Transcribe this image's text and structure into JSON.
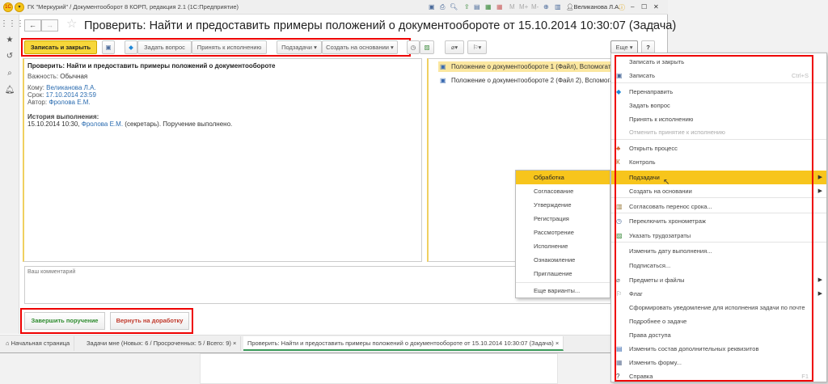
{
  "app": {
    "title": "ГК \"Меркурий\" / Документооборот 8 КОРП, редакция 2.1  (1С:Предприятие)",
    "user": "Великанова Л.А.",
    "memory_buttons": [
      "M",
      "M+",
      "M-"
    ]
  },
  "form": {
    "title": "Проверить: Найти и предоставить примеры положений о документообороте от 15.10.2014 10:30:07 (Задача)"
  },
  "toolbar": {
    "save_close": "Записать и закрыть",
    "ask": "Задать вопрос",
    "accept": "Принять к исполнению",
    "subtasks": "Подзадачи",
    "create_based": "Создать на основании",
    "more": "Еще",
    "help": "?"
  },
  "task": {
    "heading": "Проверить: Найти и предоставить примеры положений о документообороте",
    "importance_label": "Важность:",
    "importance": "Обычная",
    "to_label": "Кому:",
    "to": "Великанова Л.А.",
    "due_label": "Срок:",
    "due": "17.10.2014 23:59",
    "author_label": "Автор:",
    "author": "Фролова Е.М.",
    "history_label": "История выполнения:",
    "history_prefix": "15.10.2014 10:30,",
    "history_person": "Фролова Е.М.",
    "history_suffix": "(секретарь). Поручение выполнено."
  },
  "files": [
    "Положение о документообороте 1 (Файл), Вспомогатель",
    "Положение о документообороте 2 (Файл 2), Вспомогател"
  ],
  "comment": {
    "placeholder": "Ваш комментарий"
  },
  "actions": {
    "complete": "Завершить поручение",
    "return": "Вернуть на доработку"
  },
  "colors": {
    "accent": "#f7c51c",
    "highlight_box": "#e00000",
    "complete": "#2e8b2e",
    "return": "#c0392b"
  },
  "tabs": [
    {
      "label": "Начальная страница",
      "icon": "home-icon"
    },
    {
      "label": "Задачи мне (Новых: 6 / Просроченных: 5 / Всего: 9)"
    },
    {
      "label": "Проверить: Найти и предоставить примеры положений о документообороте от 15.10.2014 10:30:07 (Задача)",
      "active": true
    }
  ],
  "more_menu": [
    {
      "label": "Записать и закрыть"
    },
    {
      "label": "Записать",
      "shortcut": "Ctrl+S",
      "icon": "save-icon"
    },
    {
      "label": "Перенаправить",
      "icon": "forward-icon"
    },
    {
      "label": "Задать вопрос"
    },
    {
      "label": "Принять к исполнению"
    },
    {
      "label": "Отменить принятие к исполнению",
      "disabled": true
    },
    {
      "label": "Открыть процесс",
      "icon": "process-icon"
    },
    {
      "label": "Контроль",
      "icon": "control-icon"
    },
    {
      "label": "Подзадачи",
      "submenu": true,
      "highlighted": true
    },
    {
      "label": "Создать на основании",
      "submenu": true
    },
    {
      "label": "Согласовать перенос срока...",
      "icon": "reschedule-icon"
    },
    {
      "label": "Переключить хронометраж",
      "icon": "clock-icon"
    },
    {
      "label": "Указать трудозатраты",
      "icon": "labor-icon"
    },
    {
      "label": "Изменить дату выполнения..."
    },
    {
      "label": "Подписаться..."
    },
    {
      "label": "Предметы и файлы",
      "submenu": true,
      "icon": "paperclip-icon"
    },
    {
      "label": "Флаг",
      "submenu": true,
      "icon": "flag-icon"
    },
    {
      "label": "Сформировать уведомление для исполнения задачи по почте"
    },
    {
      "label": "Подробнее о задаче"
    },
    {
      "label": "Права доступа"
    },
    {
      "label": "Изменить состав дополнительных реквизитов",
      "icon": "attributes-icon"
    },
    {
      "label": "Изменить форму...",
      "icon": "form-icon"
    },
    {
      "label": "Справка",
      "shortcut": "F1",
      "icon": "help-icon"
    }
  ],
  "subtasks_menu": [
    "Обработка",
    "Согласование",
    "Утверждение",
    "Регистрация",
    "Рассмотрение",
    "Исполнение",
    "Ознакомление",
    "Приглашение",
    "Еще варианты..."
  ]
}
